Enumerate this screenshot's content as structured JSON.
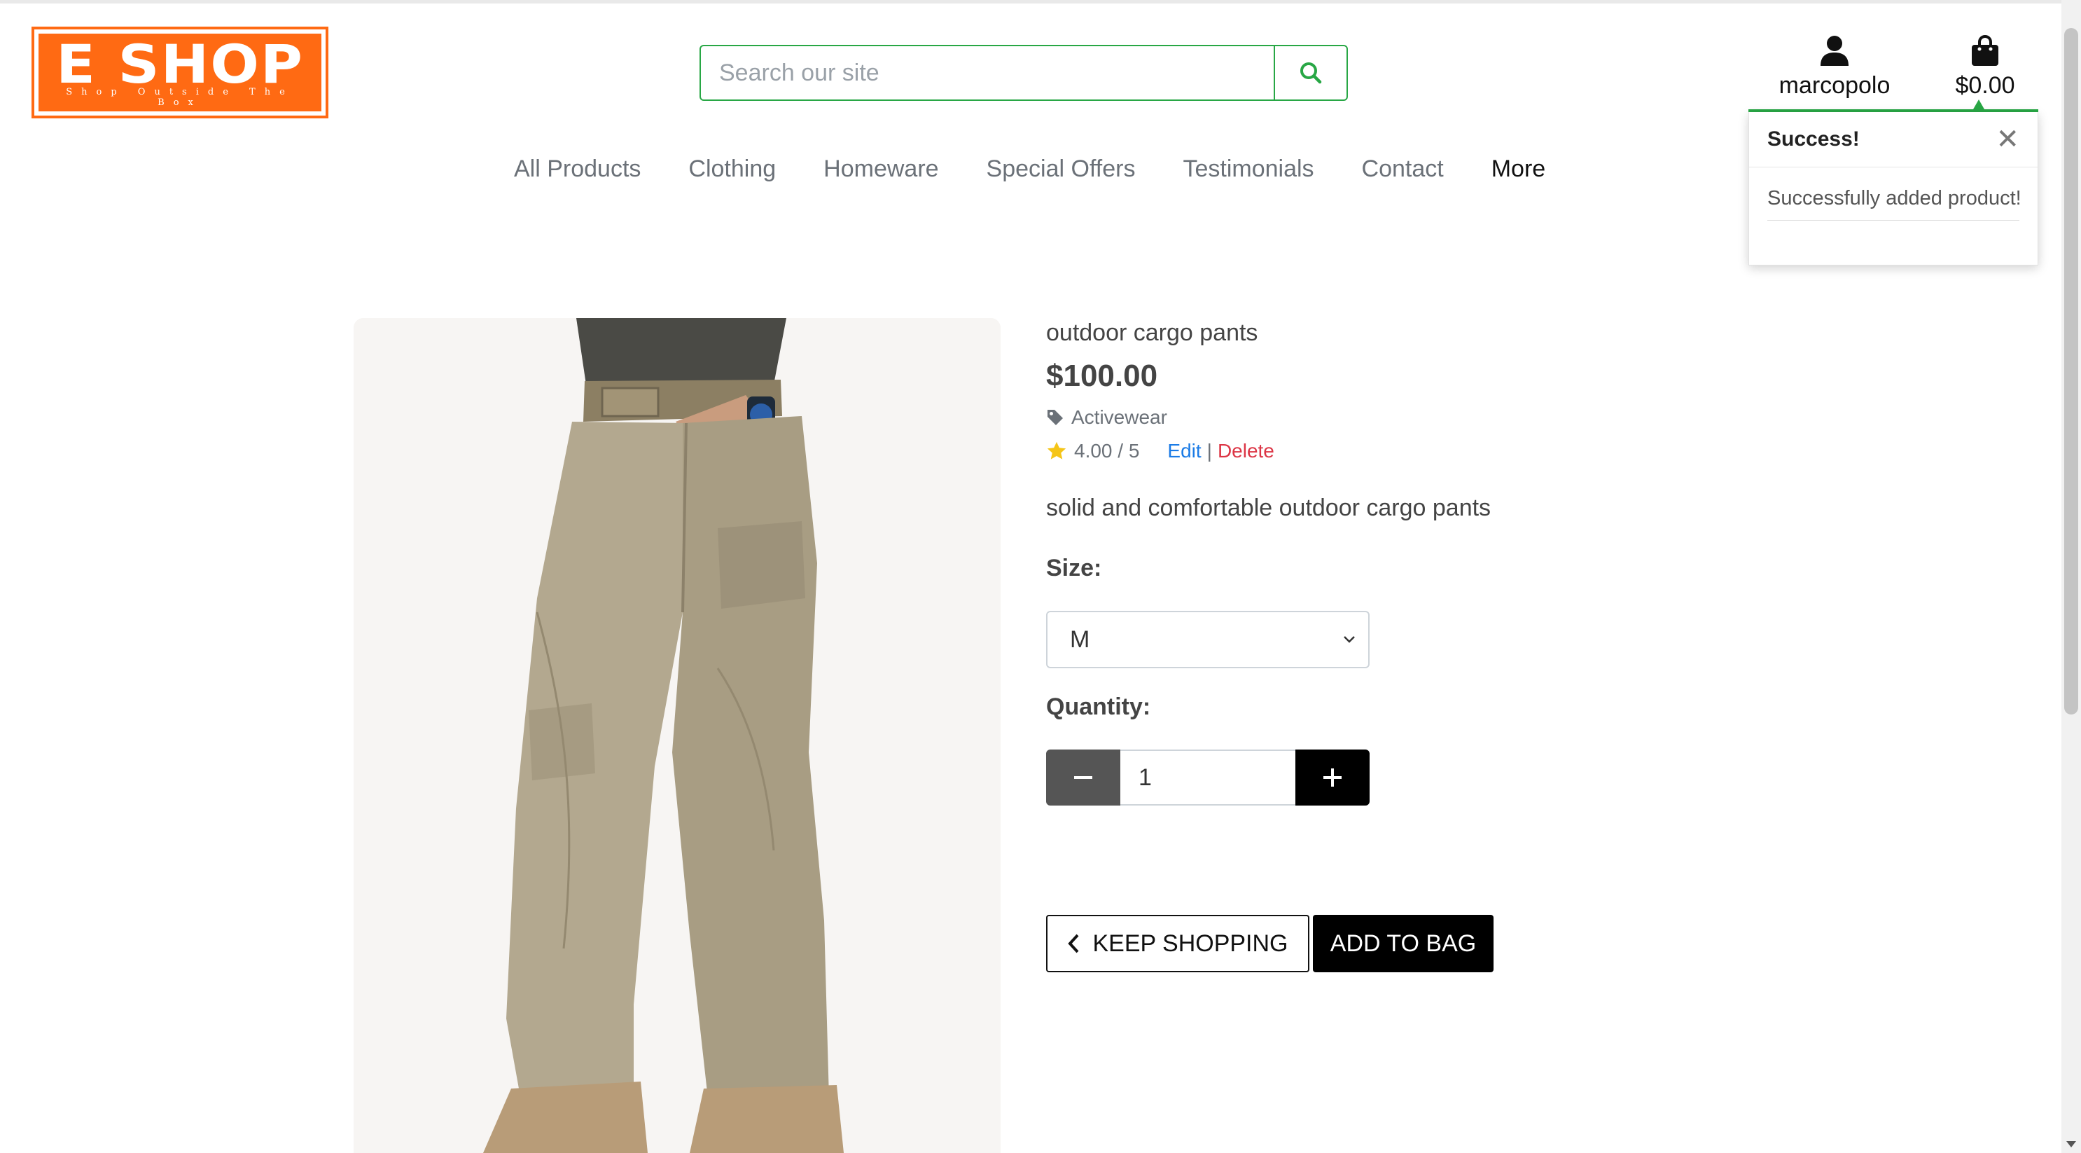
{
  "logo": {
    "title": "E SHOP",
    "tagline": "Shop Outside The Box",
    "color": "#ff6a13"
  },
  "search": {
    "placeholder": "Search our site",
    "icon": "search-icon",
    "accent": "#28a745"
  },
  "account": {
    "username": "marcopolo",
    "icon": "user-icon"
  },
  "bag": {
    "total": "$0.00",
    "icon": "shopping-bag-icon"
  },
  "toast": {
    "title": "Success!",
    "message": "Successfully added product!",
    "close_icon": "close-icon"
  },
  "nav": {
    "items": [
      {
        "label": "All Products"
      },
      {
        "label": "Clothing"
      },
      {
        "label": "Homeware"
      },
      {
        "label": "Special Offers"
      },
      {
        "label": "Testimonials"
      },
      {
        "label": "Contact"
      },
      {
        "label": "More"
      }
    ]
  },
  "product": {
    "name": "outdoor cargo pants",
    "price": "$100.00",
    "category": "Activewear",
    "category_icon": "tag-icon",
    "rating": "4.00 / 5",
    "rating_icon": "star-icon",
    "edit_label": "Edit",
    "separator": "|",
    "delete_label": "Delete",
    "description": "solid and comfortable outdoor cargo pants",
    "image_alt": "outdoor cargo pants"
  },
  "form": {
    "size_label": "Size:",
    "size_value": "M",
    "quantity_label": "Quantity:",
    "quantity_value": "1",
    "keep_shopping_label": "KEEP SHOPPING",
    "add_to_bag_label": "ADD TO BAG"
  },
  "colors": {
    "success": "#28a745",
    "link": "#1a7be6",
    "danger": "#dc3545",
    "star": "#f5c518"
  }
}
